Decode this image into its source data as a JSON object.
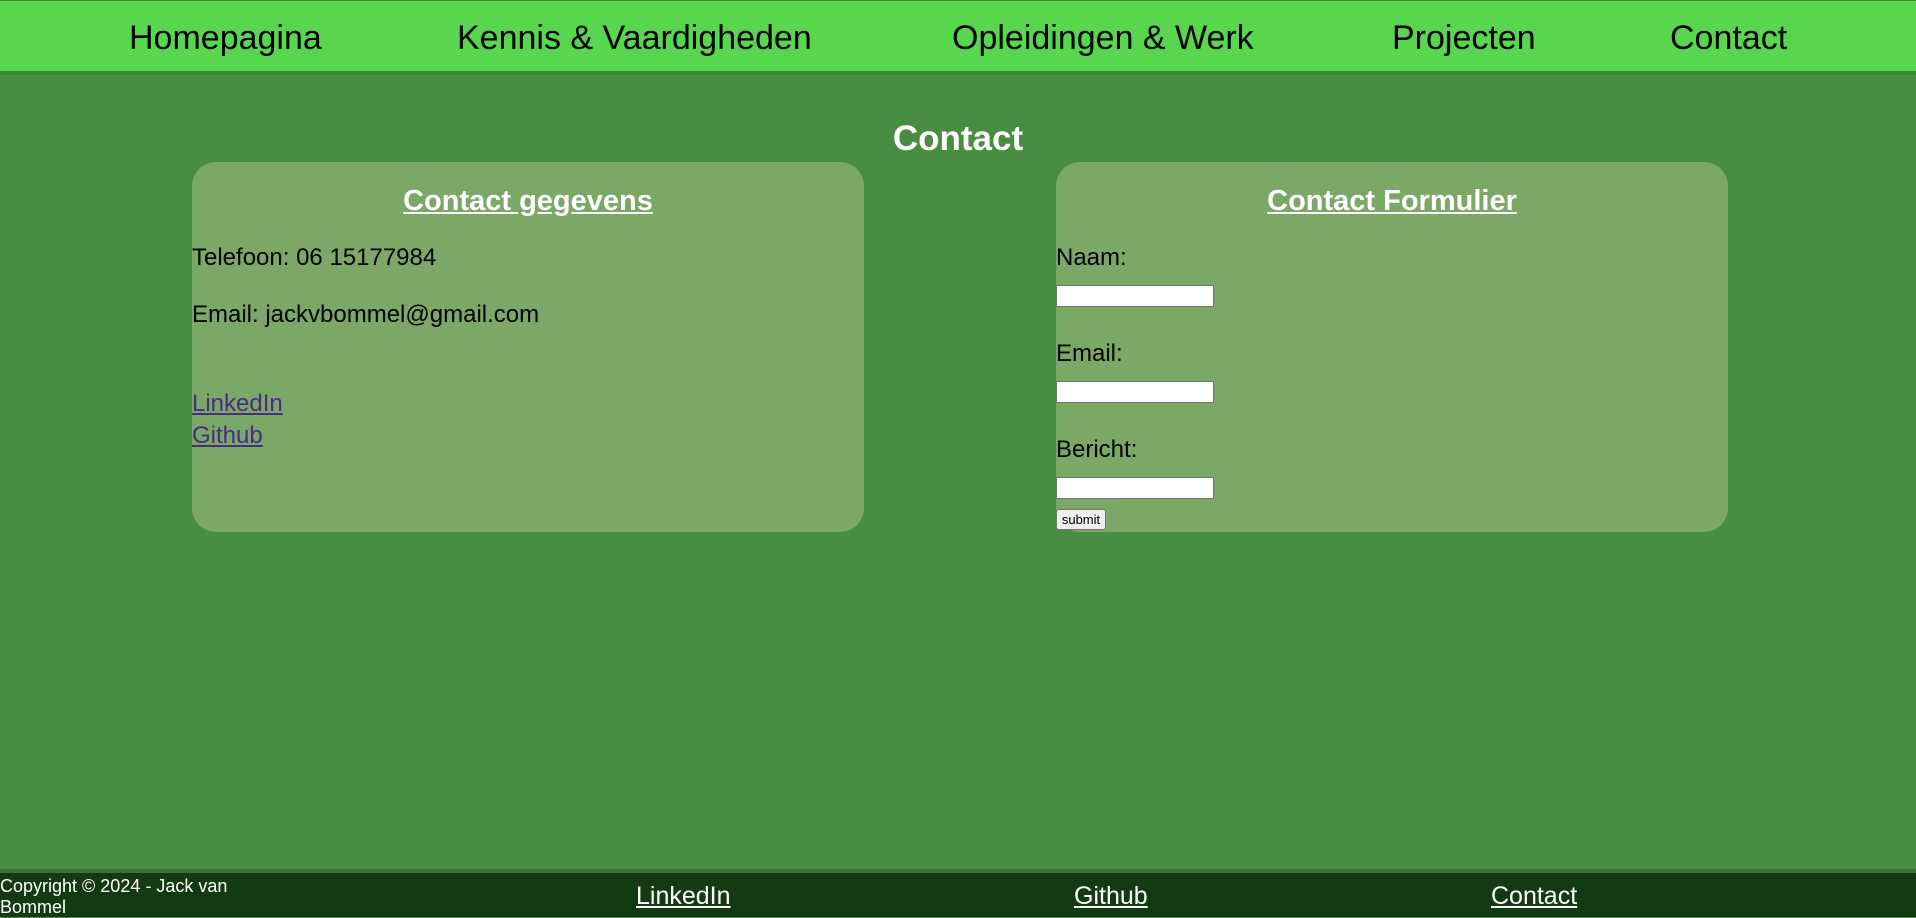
{
  "nav": {
    "items": [
      "Homepagina",
      "Kennis & Vaardigheden",
      "Opleidingen & Werk",
      "Projecten",
      "Contact"
    ]
  },
  "page_title": "Contact",
  "contact_details": {
    "heading": "Contact gegevens",
    "phone": "Telefoon: 06 15177984",
    "email": "Email: jackvbommel@gmail.com",
    "links": [
      "LinkedIn",
      "Github"
    ]
  },
  "contact_form": {
    "heading": "Contact Formulier",
    "name_label": "Naam:",
    "name_value": "",
    "email_label": "Email:",
    "email_value": "",
    "message_label": "Bericht:",
    "message_value": "",
    "submit_label": "submit"
  },
  "footer": {
    "copyright": "Copyright © 2024 - Jack van Bommel",
    "links": [
      "LinkedIn",
      "Github",
      "Contact"
    ]
  },
  "colors": {
    "background": "#498d42",
    "nav_background": "#58d74e",
    "card_background": "#7ba867",
    "footer_background": "#133a12",
    "link_visited": "#4b2a8a"
  }
}
